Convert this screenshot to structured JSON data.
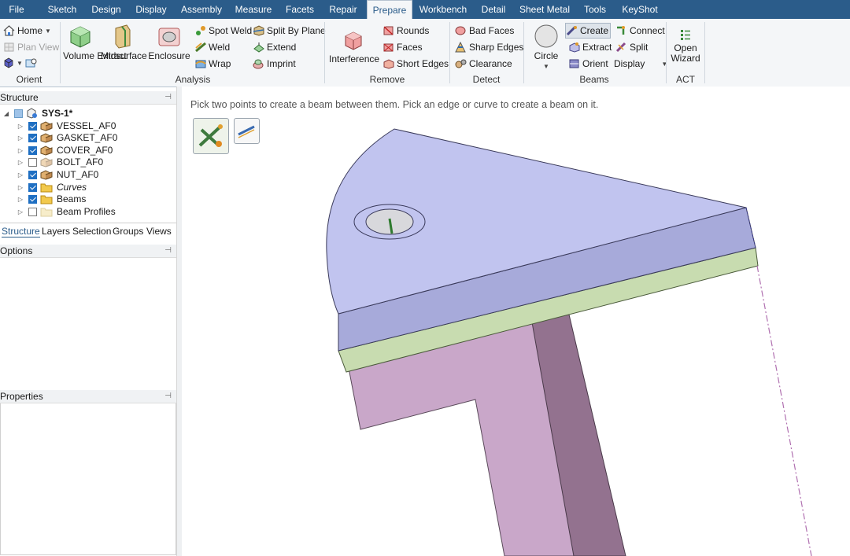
{
  "menu": {
    "tabs": [
      "File",
      "Sketch",
      "Design",
      "Display",
      "Assembly",
      "Measure",
      "Facets",
      "Repair",
      "Prepare",
      "Workbench",
      "Detail",
      "Sheet Metal",
      "Tools",
      "KeyShot"
    ],
    "active": "Prepare"
  },
  "ribbon": {
    "orient": {
      "home": "Home",
      "plan_view": "Plan View",
      "group": "Orient"
    },
    "analysis": {
      "volume_extract": "Volume Extract",
      "midsurface": "Midsurface",
      "enclosure": "Enclosure",
      "spot_weld": "Spot Weld",
      "weld": "Weld",
      "wrap": "Wrap",
      "split_by_plane": "Split By Plane",
      "extend": "Extend",
      "imprint": "Imprint",
      "group": "Analysis"
    },
    "remove": {
      "interference": "Interference",
      "rounds": "Rounds",
      "faces": "Faces",
      "short_edges": "Short Edges",
      "group": "Remove"
    },
    "detect": {
      "bad_faces": "Bad Faces",
      "sharp_edges": "Sharp Edges",
      "clearance": "Clearance",
      "group": "Detect"
    },
    "beams": {
      "circle": "Circle",
      "create": "Create",
      "extract": "Extract",
      "orient": "Orient",
      "connect": "Connect",
      "split": "Split",
      "display": "Display",
      "group": "Beams"
    },
    "act": {
      "open_wizard": "Open Wizard",
      "group": "ACT"
    }
  },
  "structure": {
    "title": "Structure",
    "root": "SYS-1*",
    "items": [
      {
        "label": "VESSEL_AF0",
        "checked": true
      },
      {
        "label": "GASKET_AF0",
        "checked": true
      },
      {
        "label": "COVER_AF0",
        "checked": true
      },
      {
        "label": "BOLT_AF0",
        "checked": false
      },
      {
        "label": "NUT_AF0",
        "checked": true
      },
      {
        "label": "Curves",
        "checked": true
      },
      {
        "label": "Beams",
        "checked": true
      },
      {
        "label": "Beam Profiles",
        "checked": false
      }
    ],
    "tabs": [
      "Structure",
      "Layers",
      "Selection",
      "Groups",
      "Views"
    ]
  },
  "options": {
    "title": "Options"
  },
  "properties": {
    "title": "Properties"
  },
  "viewport": {
    "hint": "Pick two points to create a beam between them. Pick an edge or curve to create a beam on it."
  },
  "colors": {
    "menubar": "#2b5c8a",
    "cover_top": "#c1c4ef",
    "cover_side": "#a7aada",
    "gasket": "#c8dcb0",
    "vessel": "#c9a7c9",
    "vessel_dark": "#93728f"
  }
}
